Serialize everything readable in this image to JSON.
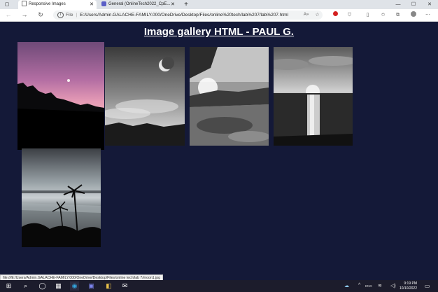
{
  "browser": {
    "tabs": [
      {
        "title": "Responsive Images",
        "active": true
      },
      {
        "title": "General (OnlineTech2022_CpE...",
        "active": false
      }
    ],
    "new_tab_label": "+",
    "window_controls": {
      "minimize": "—",
      "maximize": "☐",
      "close": "✕"
    },
    "protocol_label": "File",
    "url": "E:/Users/Admin.GALACHE-FAMILY.000/OneDrive/Desktop/Files/online%20tech/lab%207/lab%207.html"
  },
  "page": {
    "title": "Image gallery HTML - PAUL G.",
    "images": [
      {
        "name": "pink-sky-forest-hills",
        "alt": "Pink sky with moon over dark forest hills"
      },
      {
        "name": "moon-clouds-mountains",
        "alt": "Crescent moon and clouds over mountains"
      },
      {
        "name": "sunburst-river-rocks",
        "alt": "Sun over rocky river landscape"
      },
      {
        "name": "waterfall-sunrise",
        "alt": "Waterfall at sunrise"
      },
      {
        "name": "palm-beach-sunset",
        "alt": "Palm trees silhouetted on beach"
      }
    ]
  },
  "status_bar": {
    "text": "file:///E:/Users/Admin.GALACHE-FAMILY.000/OneDrive/Desktop/Files/online tech/lab 7/moon1.jpg"
  },
  "taskbar": {
    "time": "9:19 PM",
    "date": "10/10/2022",
    "tray_text": "ENG"
  },
  "colors": {
    "page_background": "#141938",
    "title_text": "#ffffff"
  }
}
